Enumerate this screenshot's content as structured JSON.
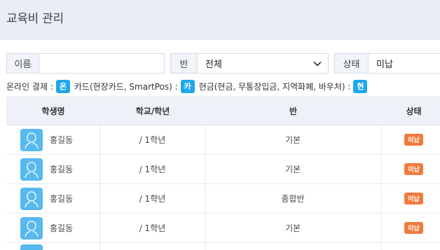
{
  "page_title": "교육비 관리",
  "filters": {
    "name_label": "이름",
    "name_value": "",
    "class_label": "반",
    "class_value": "전체",
    "status_label": "상태",
    "status_value": "미납"
  },
  "legend": {
    "online_text": "온라인 결제 :",
    "online_chip": "온",
    "card_text": "카드(현장카드, SmartPos) :",
    "card_chip": "카",
    "cash_text": "현금(현금, 무통장입금, 지역화폐, 바우처) :",
    "cash_chip": "현"
  },
  "table": {
    "headers": [
      "학생명",
      "학교/학년",
      "반",
      "상태"
    ],
    "rows": [
      {
        "name": "홍길동",
        "grade": "/ 1학년",
        "class": "기본",
        "status": "미납"
      },
      {
        "name": "홍길동",
        "grade": "/ 1학년",
        "class": "기본",
        "status": "미납"
      },
      {
        "name": "홍길동",
        "grade": "/ 1학년",
        "class": "종합반",
        "status": "미납"
      },
      {
        "name": "홍길동",
        "grade": "/ 1학년",
        "class": "기본",
        "status": "미납"
      }
    ]
  },
  "colors": {
    "accent": "#1ea7ec",
    "status_badge": "#f07b3f",
    "avatar": "#58b9ee",
    "header_bg": "#e8edf7"
  },
  "icons": {
    "avatar": "user-avatar-icon",
    "dropdown": "chevron-down-icon"
  }
}
